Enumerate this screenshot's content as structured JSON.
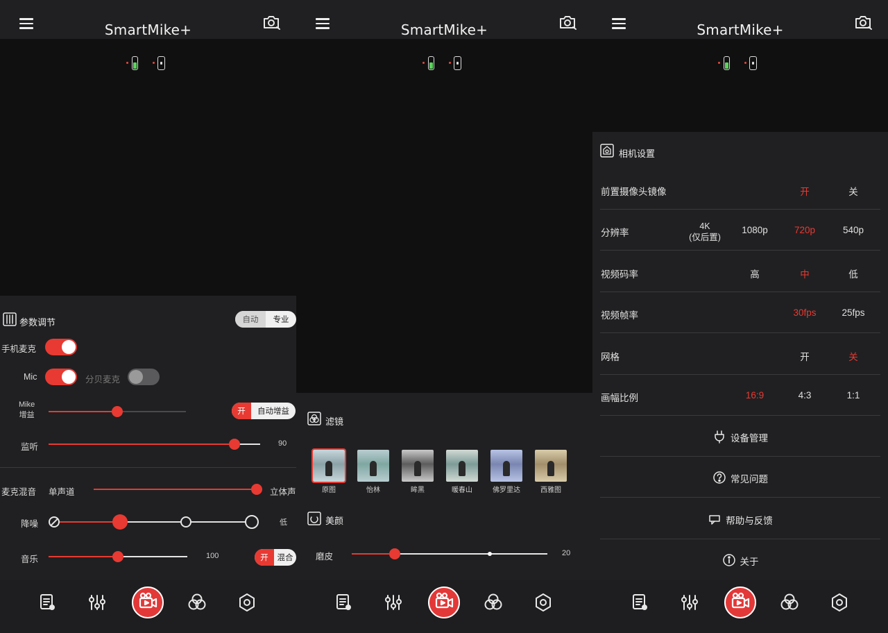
{
  "app": {
    "title": "SmartMike+"
  },
  "panel1": {
    "section_title": "参数调节",
    "mode": [
      "自动",
      "专业"
    ],
    "phone_mic_label": "手机麦克",
    "mic_label": "Mic",
    "split_mic_label": "分贝麦克",
    "mike_gain_label": "Mike\n增益",
    "auto_gain": [
      "开",
      "自动增益"
    ],
    "monitor_label": "监听",
    "monitor_value": "90",
    "channel_label": "麦克混音",
    "mono_label": "单声道",
    "stereo_label": "立体声",
    "reverb_label": "降噪",
    "reverb_end": "低",
    "music_label": "音乐",
    "music_value": "100",
    "music_toggle": [
      "开",
      "混合"
    ],
    "state": {
      "monitor": 0.88,
      "mike_gain": 0.5,
      "channel": 1.0,
      "reverb_step": 1,
      "music": 0.5,
      "phone_mic": true,
      "mic": true,
      "split_mic": false
    }
  },
  "panel2": {
    "filter_title": "滤镜",
    "filters": [
      {
        "name": "原图",
        "colors": [
          "#8aa2a6",
          "#c9d7dc"
        ]
      },
      {
        "name": "怡林",
        "colors": [
          "#7fa7a2",
          "#b9cdd0"
        ]
      },
      {
        "name": "眸黑",
        "colors": [
          "#5c5c5c",
          "#c9c9c9"
        ]
      },
      {
        "name": "暖春山",
        "colors": [
          "#7d9b98",
          "#d2dad4"
        ]
      },
      {
        "name": "佛罗里达",
        "colors": [
          "#7a86b0",
          "#b8c3e6"
        ]
      },
      {
        "name": "西雅图",
        "colors": [
          "#a28e6a",
          "#d9ccaa"
        ]
      }
    ],
    "beauty_title": "美颜",
    "skin_label": "磨皮",
    "skin_value": "20",
    "state": {
      "selected_filter": 0,
      "skin": 0.22
    }
  },
  "panel3": {
    "section_title": "相机设置",
    "rows": [
      {
        "label": "前置摄像头镜像",
        "options": [
          {
            "text": "开",
            "sel": true
          },
          {
            "text": "关",
            "sel": false
          }
        ]
      },
      {
        "label": "分辨率",
        "options": [
          {
            "text": "4K\n(仅后置)",
            "sel": false
          },
          {
            "text": "1080p",
            "sel": false
          },
          {
            "text": "720p",
            "sel": true
          },
          {
            "text": "540p",
            "sel": false
          }
        ]
      },
      {
        "label": "视频码率",
        "options": [
          {
            "text": "高",
            "sel": false
          },
          {
            "text": "中",
            "sel": true
          },
          {
            "text": "低",
            "sel": false
          }
        ]
      },
      {
        "label": "视频帧率",
        "options": [
          {
            "text": "30fps",
            "sel": true
          },
          {
            "text": "25fps",
            "sel": false
          }
        ]
      },
      {
        "label": "网格",
        "options": [
          {
            "text": "开",
            "sel": false
          },
          {
            "text": "关",
            "sel": true
          }
        ]
      },
      {
        "label": "画幅比例",
        "options": [
          {
            "text": "16:9",
            "sel": true
          },
          {
            "text": "4:3",
            "sel": false
          },
          {
            "text": "1:1",
            "sel": false
          }
        ]
      }
    ],
    "links": [
      "设备管理",
      "常见问题",
      "帮助与反馈",
      "关于"
    ]
  },
  "nav": [
    "script-icon",
    "sliders-icon",
    "record-icon",
    "filters-icon",
    "settings-icon"
  ],
  "colors": {
    "accent": "#e83a32",
    "bg": "#101011",
    "sheet": "#202022"
  }
}
